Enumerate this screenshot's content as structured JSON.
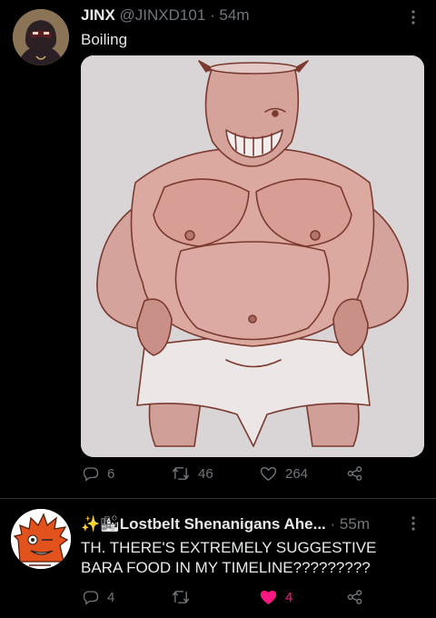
{
  "tweet1": {
    "author_name": "JINX",
    "handle": "@JINXD101",
    "separator": "·",
    "time": "54m",
    "text": "Boiling",
    "replies": "6",
    "retweets": "46",
    "likes": "264"
  },
  "tweet2": {
    "emoji_prefix": "✨🏙",
    "author_name": "Lostbelt Shenanigans Ahe...",
    "separator": "·",
    "time": "55m",
    "text_line1": "TH. THERE'S EXTREMELY SUGGESTIVE",
    "text_line2": "BARA FOOD IN MY TIMELINE?????????",
    "replies": "4",
    "retweets": "",
    "likes": "4",
    "liked": true
  },
  "colors": {
    "background": "#000000",
    "text": "#e7e9ea",
    "muted": "#71767b",
    "like_active": "#f91880",
    "divider": "#2f3336"
  },
  "icons": [
    "more-icon",
    "reply-icon",
    "retweet-icon",
    "like-icon",
    "share-icon"
  ]
}
